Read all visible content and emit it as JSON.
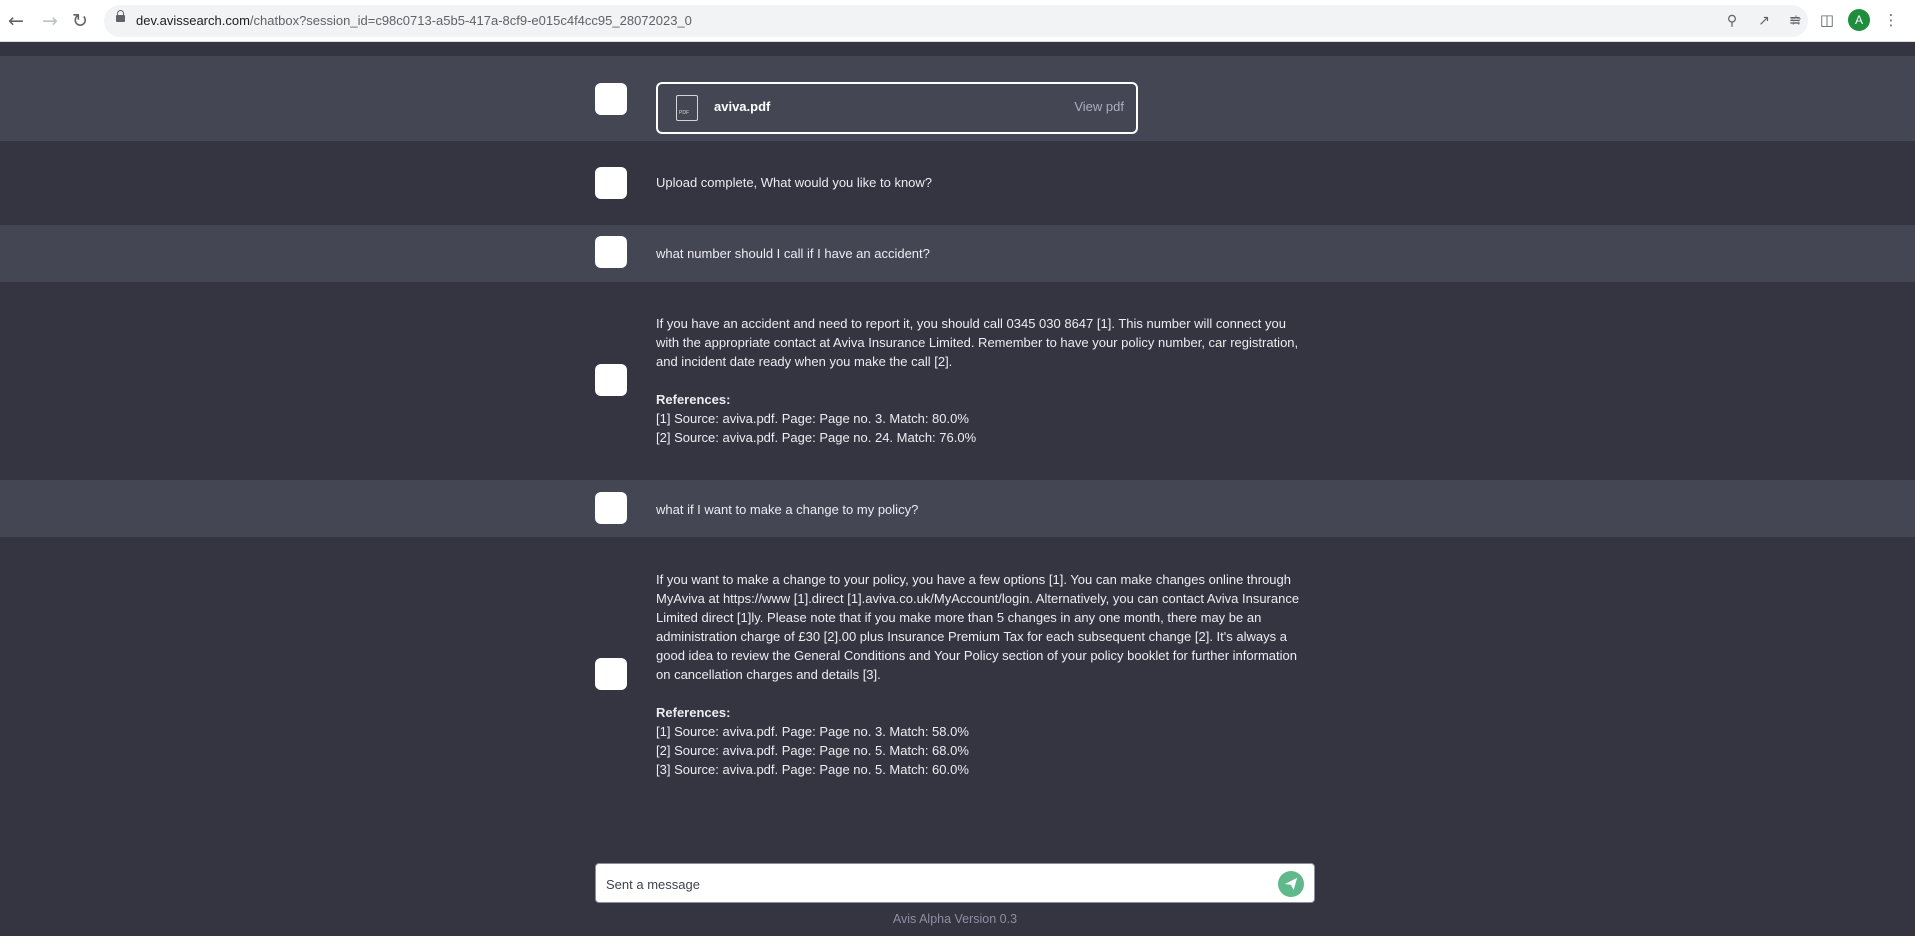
{
  "browser": {
    "url_host": "dev.avissearch.com",
    "url_path": "/chatbox?session_id=c98c0713-a5b5-417a-8cf9-e015c4f4cc95_28072023_0",
    "avatar_letter": "A",
    "icons": [
      "back-icon",
      "forward-icon",
      "reload-icon",
      "lock-icon",
      "zoom-icon",
      "share-icon",
      "bookmark-star-icon",
      "media-queue-icon",
      "side-panel-icon",
      "profile-avatar",
      "kebab-menu-icon"
    ]
  },
  "upload": {
    "file_name": "aviva.pdf",
    "view_label": "View pdf"
  },
  "messages": [
    {
      "role": "bot",
      "text": "Upload complete, What would you like to know?"
    },
    {
      "role": "user",
      "text": "what number should I call if I have an accident?"
    },
    {
      "role": "bot",
      "text": "If you have an accident and need to report it, you should call 0345 030 8647 [1]. This number will connect you with the appropriate contact at Aviva Insurance Limited. Remember to have your policy number, car registration, and incident date ready when you make the call [2].",
      "references_label": "References:",
      "references": [
        "[1] Source: aviva.pdf. Page: Page no. 3. Match: 80.0%",
        "[2] Source: aviva.pdf. Page: Page no. 24. Match: 76.0%"
      ]
    },
    {
      "role": "user",
      "text": "what if I want to make a change to my policy?"
    },
    {
      "role": "bot",
      "text": "If you want to make a change to your policy, you have a few options [1]. You can make changes online through MyAviva at https://www [1].direct [1].aviva.co.uk/MyAccount/login. Alternatively, you can contact Aviva Insurance Limited direct [1]ly. Please note that if you make more than 5 changes in any one month, there may be an administration charge of £30 [2].00 plus Insurance Premium Tax for each subsequent change [2]. It's always a good idea to review the General Conditions and Your Policy section of your policy booklet for further information on cancellation charges and details [3].",
      "references_label": "References:",
      "references": [
        "[1] Source: aviva.pdf. Page: Page no. 3. Match: 58.0%",
        "[2] Source: aviva.pdf. Page: Page no. 5. Match: 68.0%",
        "[3] Source: aviva.pdf. Page: Page no. 5. Match: 60.0%"
      ]
    }
  ],
  "composer": {
    "placeholder": "Sent a message"
  },
  "footer": {
    "version": "Avis Alpha Version 0.3"
  },
  "colors": {
    "dark_row": "#343541",
    "light_row": "#444654",
    "send_button": "#5fb98a"
  }
}
